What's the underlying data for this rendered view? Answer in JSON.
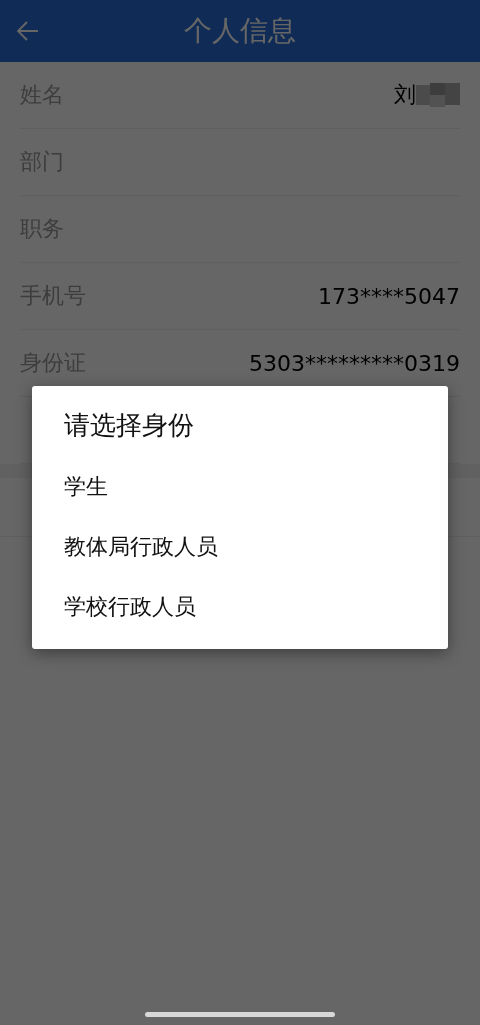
{
  "header": {
    "title": "个人信息"
  },
  "rows": [
    {
      "label": "姓名",
      "value": "刘",
      "redacted": true
    },
    {
      "label": "部门"
    },
    {
      "label": "职务"
    },
    {
      "label": "手机号",
      "value": "173****5047"
    },
    {
      "label": "身份证",
      "value": "5303*********0319"
    },
    {}
  ],
  "dialog": {
    "title": "请选择身份",
    "options": [
      "学生",
      "教体局行政人员",
      "学校行政人员"
    ]
  }
}
